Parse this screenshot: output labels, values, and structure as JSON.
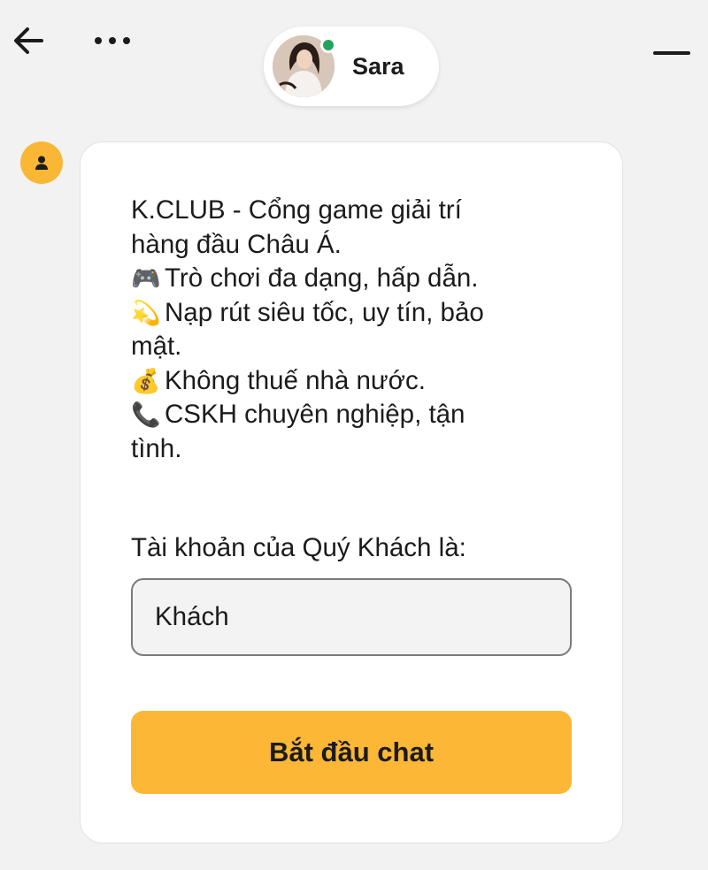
{
  "header": {
    "agent_name": "Sara",
    "online_color": "#22a55a",
    "icons": {
      "back": "arrow-left-icon",
      "more": "more-horizontal-icon",
      "minimize": "minimize-icon"
    }
  },
  "message": {
    "lines": [
      {
        "emoji": "",
        "text": "K.CLUB - Cổng game giải trí"
      },
      {
        "emoji": "",
        "text": "hàng đầu Châu Á."
      },
      {
        "emoji": "🎮",
        "text": "Trò chơi đa dạng, hấp dẫn."
      },
      {
        "emoji": "💫",
        "text": "Nạp rút siêu tốc, uy tín, bảo"
      },
      {
        "emoji": "",
        "text": "mật."
      },
      {
        "emoji": "💰",
        "text": "Không thuế nhà nước."
      },
      {
        "emoji": "📞",
        "text": "CSKH chuyên nghiệp, tận"
      },
      {
        "emoji": "",
        "text": "tình."
      }
    ]
  },
  "form": {
    "account_label": "Tài khoản của Quý Khách là:",
    "account_value": "Khách",
    "start_button": "Bắt đầu chat"
  },
  "colors": {
    "accent": "#fbb735",
    "background": "#f2f2f2",
    "card": "#ffffff"
  }
}
